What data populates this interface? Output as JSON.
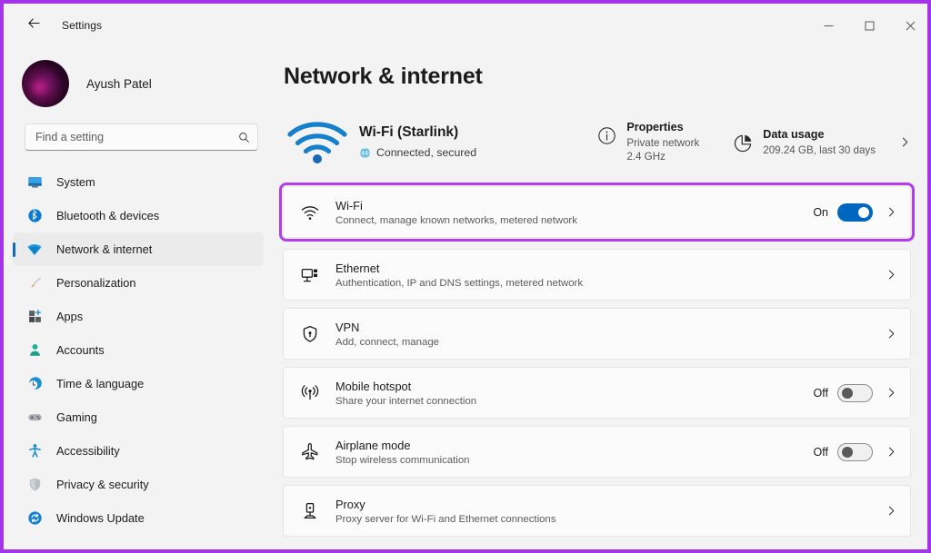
{
  "window": {
    "titlebar_text": "Settings",
    "back_icon": "arrow-left-icon",
    "minimize_label": "–",
    "maximize_label": "□",
    "close_label": "✕"
  },
  "accent_colors": {
    "annotation_border": "#a334e8",
    "toggle_on": "#0067c0",
    "nav_indicator": "#0f6cbd",
    "wifi_blue": "#0f72ba",
    "window_background": "#f3f3f3",
    "card_background": "#fbfbfb"
  },
  "sidebar": {
    "account": {
      "name": "Ayush Patel"
    },
    "search": {
      "placeholder": "Find a setting",
      "value": ""
    },
    "items": [
      {
        "label": "System",
        "icon": "monitor-icon",
        "active": false
      },
      {
        "label": "Bluetooth & devices",
        "icon": "bluetooth-icon",
        "active": false
      },
      {
        "label": "Network & internet",
        "icon": "wifi-icon",
        "active": true
      },
      {
        "label": "Personalization",
        "icon": "paintbrush-icon",
        "active": false
      },
      {
        "label": "Apps",
        "icon": "apps-grid-icon",
        "active": false
      },
      {
        "label": "Accounts",
        "icon": "person-icon",
        "active": false
      },
      {
        "label": "Time & language",
        "icon": "clock-globe-icon",
        "active": false
      },
      {
        "label": "Gaming",
        "icon": "gamepad-icon",
        "active": false
      },
      {
        "label": "Accessibility",
        "icon": "accessibility-person-icon",
        "active": false
      },
      {
        "label": "Privacy & security",
        "icon": "shield-icon",
        "active": false
      },
      {
        "label": "Windows Update",
        "icon": "update-refresh-icon",
        "active": false
      }
    ]
  },
  "main": {
    "page_title": "Network & internet",
    "status": {
      "icon": "wifi-signal-large-icon",
      "title": "Wi-Fi (Starlink)",
      "sub_icon": "globe-icon",
      "sub_text": "Connected, secured"
    },
    "status_cards": [
      {
        "icon": "info-circle-icon",
        "title": "Properties",
        "line1": "Private network",
        "line2": "2.4 GHz"
      },
      {
        "icon": "pie-chart-icon",
        "title": "Data usage",
        "line1": "209.24 GB, last 30 days",
        "line2": ""
      }
    ],
    "card_chevron": "chevron-right-icon",
    "rows": [
      {
        "icon": "wifi-icon",
        "title": "Wi-Fi",
        "sub": "Connect, manage known networks, metered network",
        "toggle_label": "On",
        "toggle_state": "on",
        "highlighted": true,
        "chevron": "chevron-right-icon"
      },
      {
        "icon": "ethernet-icon",
        "title": "Ethernet",
        "sub": "Authentication, IP and DNS settings, metered network",
        "toggle_label": "",
        "toggle_state": "none",
        "highlighted": false,
        "chevron": "chevron-right-icon"
      },
      {
        "icon": "vpn-shield-icon",
        "title": "VPN",
        "sub": "Add, connect, manage",
        "toggle_label": "",
        "toggle_state": "none",
        "highlighted": false,
        "chevron": "chevron-right-icon"
      },
      {
        "icon": "hotspot-broadcast-icon",
        "title": "Mobile hotspot",
        "sub": "Share your internet connection",
        "toggle_label": "Off",
        "toggle_state": "off",
        "highlighted": false,
        "chevron": "chevron-right-icon"
      },
      {
        "icon": "airplane-icon",
        "title": "Airplane mode",
        "sub": "Stop wireless communication",
        "toggle_label": "Off",
        "toggle_state": "off",
        "highlighted": false,
        "chevron": "chevron-right-icon"
      },
      {
        "icon": "proxy-server-icon",
        "title": "Proxy",
        "sub": "Proxy server for Wi-Fi and Ethernet connections",
        "toggle_label": "",
        "toggle_state": "none",
        "highlighted": false,
        "chevron": "chevron-right-icon"
      }
    ]
  }
}
